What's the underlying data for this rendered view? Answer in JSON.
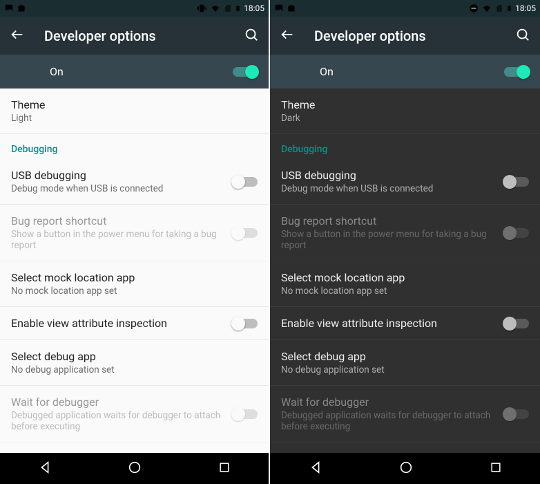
{
  "statusbar": {
    "time": "18:05"
  },
  "appbar": {
    "title": "Developer options"
  },
  "master": {
    "label": "On"
  },
  "theme_label": "Theme",
  "section_debugging": "Debugging",
  "usb_debugging": {
    "title": "USB debugging",
    "sub": "Debug mode when USB is connected"
  },
  "bug_report": {
    "title": "Bug report shortcut",
    "sub": "Show a button in the power menu for taking a bug report"
  },
  "mock_location": {
    "title": "Select mock location app",
    "sub": "No mock location app set"
  },
  "attr_inspect": {
    "title": "Enable view attribute inspection"
  },
  "debug_app": {
    "title": "Select debug app",
    "sub": "No debug application set"
  },
  "wait_debugger": {
    "title": "Wait for debugger",
    "sub": "Debugged application waits for debugger to attach before executing"
  },
  "left": {
    "theme_value": "Light"
  },
  "right": {
    "theme_value": "Dark"
  }
}
